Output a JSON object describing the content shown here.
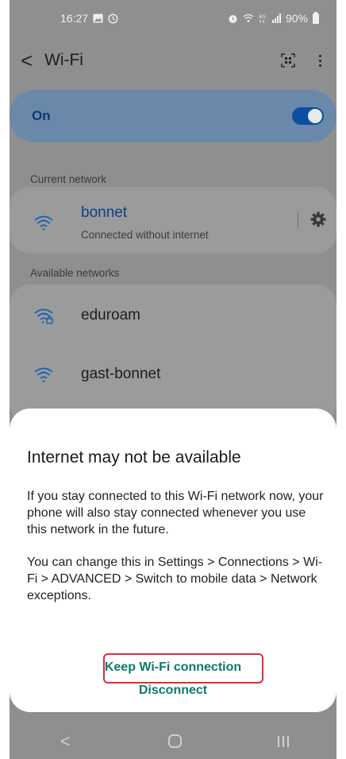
{
  "status_bar": {
    "time": "16:27",
    "left_icons": [
      "image-icon",
      "timer-icon"
    ],
    "right_icons": [
      "alarm-icon",
      "wifi-signal-icon",
      "4g-icon",
      "cell-signal-icon"
    ],
    "battery": "90%"
  },
  "app_bar": {
    "back": "<",
    "title": "Wi-Fi",
    "icons": [
      "qr-scan-icon",
      "more-options-icon"
    ]
  },
  "wifi_toggle": {
    "label": "On",
    "state": true
  },
  "sections": {
    "current": "Current network",
    "available": "Available networks"
  },
  "current_network": {
    "name": "bonnet",
    "status": "Connected without internet",
    "icon": "wifi-icon",
    "settings_icon": "gear-icon"
  },
  "available_networks": [
    {
      "name": "eduroam",
      "icon": "wifi-locked-icon"
    },
    {
      "name": "gast-bonnet",
      "icon": "wifi-icon"
    }
  ],
  "dialog": {
    "title": "Internet may not be available",
    "paragraph1": "If you stay connected to this Wi-Fi network now, your phone will also stay connected whenever you use this network in the future.",
    "paragraph2": "You can change this in Settings > Connections > Wi-Fi > ADVANCED > Switch to mobile data > Network exceptions.",
    "keep_button": "Keep Wi-Fi connection",
    "disconnect_button": "Disconnect"
  },
  "nav_bar": {
    "back": "<",
    "icons": [
      "back-icon",
      "home-icon",
      "recent-apps-icon"
    ]
  },
  "colors": {
    "accent": "#0d7a70",
    "toggle": "#0b4fa0",
    "highlight": "#d9303b"
  }
}
